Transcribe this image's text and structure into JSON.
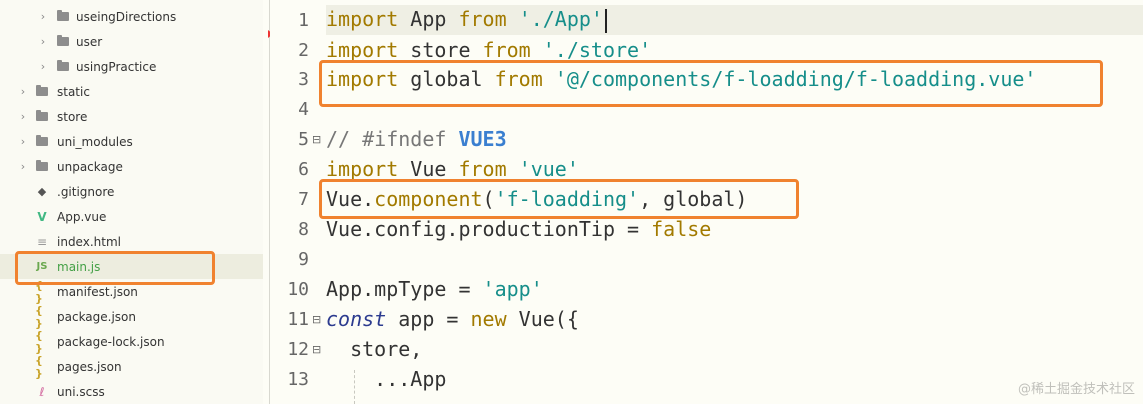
{
  "sidebar": {
    "items": [
      {
        "label": "useingDirections",
        "icon": "folder-icon",
        "expandable": true
      },
      {
        "label": "user",
        "icon": "folder-icon",
        "expandable": true
      },
      {
        "label": "usingPractice",
        "icon": "folder-icon",
        "expandable": true
      },
      {
        "label": "static",
        "icon": "folder-icon",
        "expandable": true
      },
      {
        "label": "store",
        "icon": "folder-icon",
        "expandable": true
      },
      {
        "label": "uni_modules",
        "icon": "folder-icon",
        "expandable": true
      },
      {
        "label": "unpackage",
        "icon": "folder-icon",
        "expandable": true
      },
      {
        "label": ".gitignore",
        "icon": "git-file-icon",
        "icon_text": "◆",
        "expandable": false
      },
      {
        "label": "App.vue",
        "icon": "vue-file-icon",
        "icon_text": "V",
        "expandable": false
      },
      {
        "label": "index.html",
        "icon": "html-file-icon",
        "icon_text": "≡",
        "expandable": false
      },
      {
        "label": "main.js",
        "icon": "js-file-icon",
        "icon_text": "JS",
        "expandable": false,
        "active": true
      },
      {
        "label": "manifest.json",
        "icon": "json-file-icon",
        "icon_text": "{ }",
        "expandable": false
      },
      {
        "label": "package.json",
        "icon": "json-file-icon",
        "icon_text": "{ }",
        "expandable": false
      },
      {
        "label": "package-lock.json",
        "icon": "json-file-icon",
        "icon_text": "{ }",
        "expandable": false
      },
      {
        "label": "pages.json",
        "icon": "json-file-icon",
        "icon_text": "{ }",
        "expandable": false
      },
      {
        "label": "uni.scss",
        "icon": "scss-file-icon",
        "icon_text": "ℓ",
        "expandable": false
      }
    ],
    "chevron": "›"
  },
  "editor": {
    "fold_glyph": "⊟",
    "lines": [
      {
        "n": "1",
        "code": "import App from './App'"
      },
      {
        "n": "2",
        "code": "import store from './store'"
      },
      {
        "n": "3",
        "code": "import global from '@/components/f-loadding/f-loadding.vue'"
      },
      {
        "n": "4",
        "code": ""
      },
      {
        "n": "5",
        "code": "// #ifndef VUE3"
      },
      {
        "n": "6",
        "code": "import Vue from 'vue'"
      },
      {
        "n": "7",
        "code": "Vue.component('f-loadding', global)"
      },
      {
        "n": "8",
        "code": "Vue.config.productionTip = false"
      },
      {
        "n": "9",
        "code": ""
      },
      {
        "n": "10",
        "code": "App.mpType = 'app'"
      },
      {
        "n": "11",
        "code": "const app = new Vue({"
      },
      {
        "n": "12",
        "code": "  store,"
      },
      {
        "n": "13",
        "code": "    ...App"
      }
    ]
  },
  "colors": {
    "highlight_box": "#f0822f",
    "keyword": "#a27a00",
    "string": "#168e8a",
    "active_file": "#44a046"
  },
  "watermark": "@稀土掘金技术社区"
}
